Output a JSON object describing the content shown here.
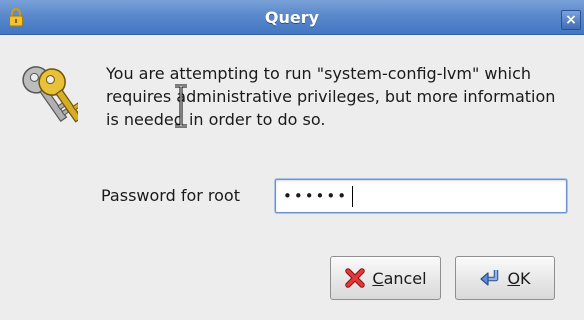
{
  "window": {
    "title": "Query",
    "close_glyph": "×"
  },
  "icons": {
    "title_icon": "padlock-icon",
    "dialog_icon": "keys-icon",
    "cancel_icon": "red-x-icon",
    "ok_icon": "return-arrow-icon"
  },
  "message": "You are attempting to run \"system-config-lvm\" which requires administrative privileges, but more information is needed in order to do so.",
  "password": {
    "label": "Password for root",
    "value": "••••••"
  },
  "buttons": {
    "cancel": {
      "mnemonic": "C",
      "rest": "ancel"
    },
    "ok": {
      "mnemonic": "O",
      "rest": "K"
    }
  },
  "colors": {
    "titlebar": "#4a7ec8",
    "background": "#ededed",
    "focus_border": "#6d94cf"
  }
}
